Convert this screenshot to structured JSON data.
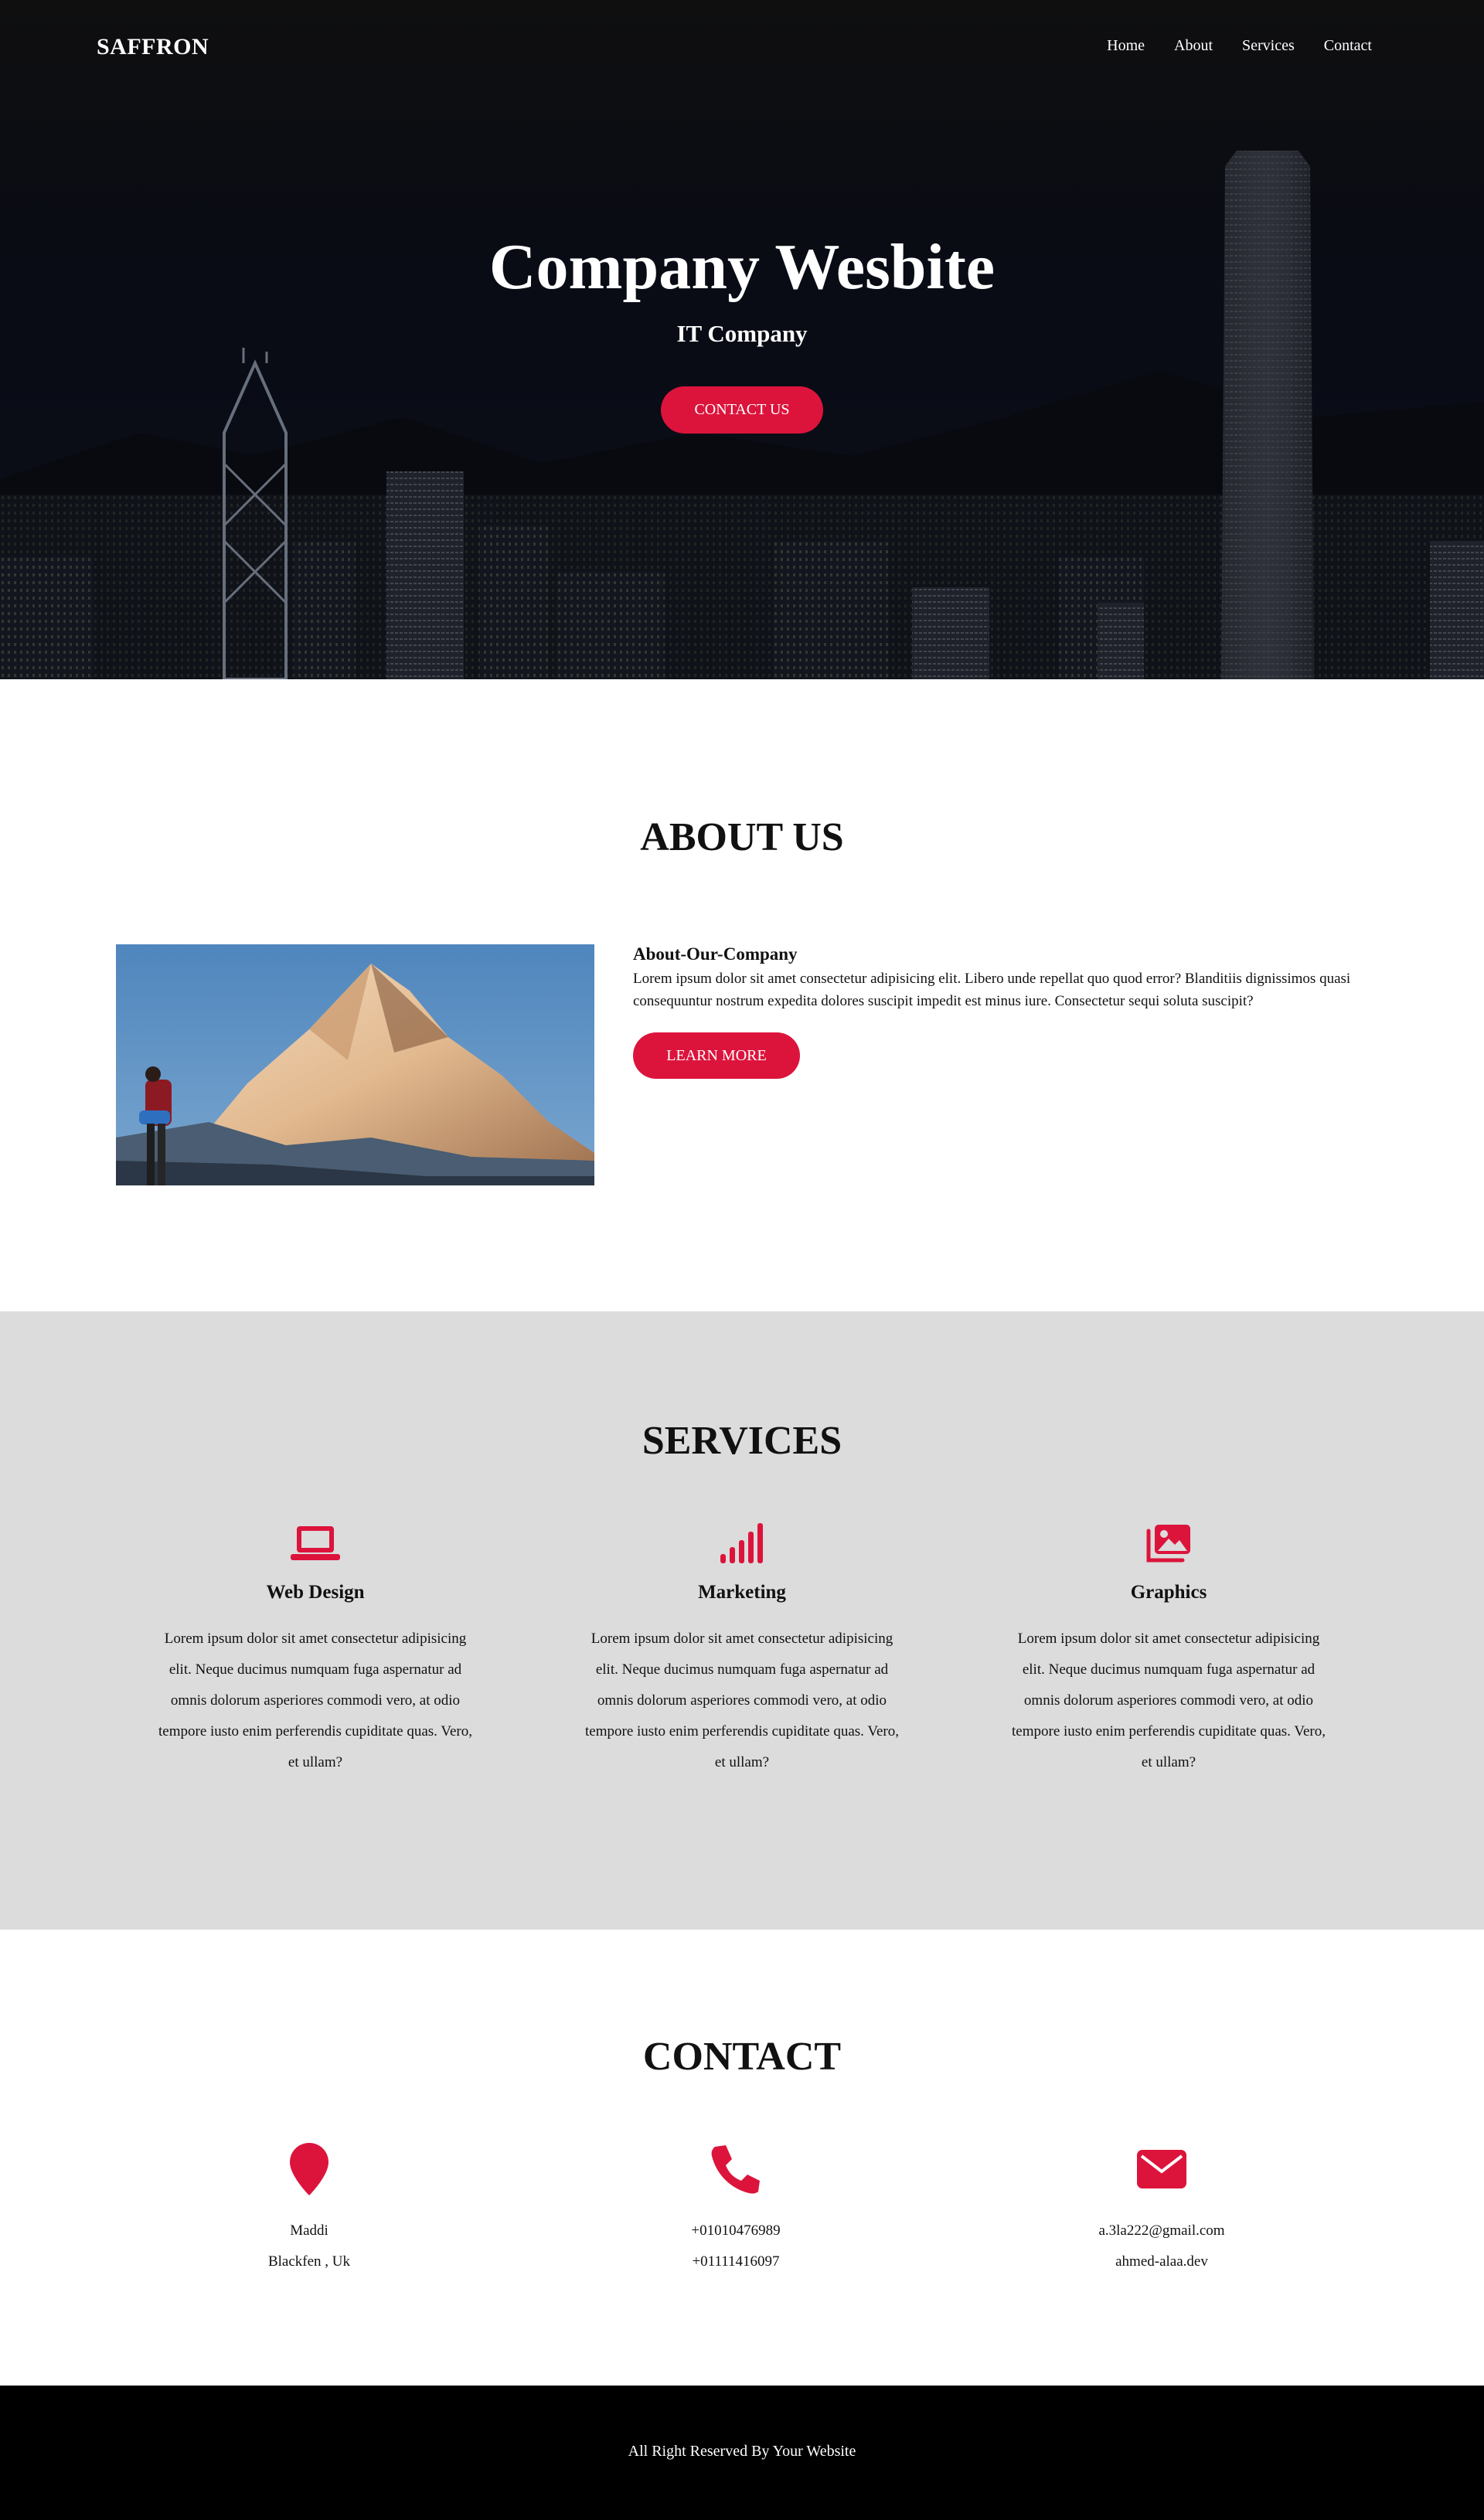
{
  "nav": {
    "brand": "SAFFRON",
    "links": [
      "Home",
      "About",
      "Services",
      "Contact"
    ]
  },
  "hero": {
    "title": "Company Wesbite",
    "subtitle": "IT Company",
    "button": "CONTACT US"
  },
  "about": {
    "title": "ABOUT US",
    "heading": "About-Our-Company",
    "paragraph": "Lorem ipsum dolor sit amet consectetur adipisicing elit. Libero unde repellat quo quod error? Blanditiis dignissimos quasi consequuntur nostrum expedita dolores suscipit impedit est minus iure. Consectetur sequi soluta suscipit?",
    "button": "LEARN MORE"
  },
  "services": {
    "title": "SERVICES",
    "items": [
      {
        "icon": "laptop-icon",
        "name": "Web Design",
        "desc": "Lorem ipsum dolor sit amet consectetur adipisicing elit. Neque ducimus numquam fuga aspernatur ad omnis dolorum asperiores commodi vero, at odio tempore iusto enim perferendis cupiditate quas. Vero, et ullam?"
      },
      {
        "icon": "signal-icon",
        "name": "Marketing",
        "desc": "Lorem ipsum dolor sit amet consectetur adipisicing elit. Neque ducimus numquam fuga aspernatur ad omnis dolorum asperiores commodi vero, at odio tempore iusto enim perferendis cupiditate quas. Vero, et ullam?"
      },
      {
        "icon": "images-icon",
        "name": "Graphics",
        "desc": "Lorem ipsum dolor sit amet consectetur adipisicing elit. Neque ducimus numquam fuga aspernatur ad omnis dolorum asperiores commodi vero, at odio tempore iusto enim perferendis cupiditate quas. Vero, et ullam?"
      }
    ]
  },
  "contact": {
    "title": "CONTACT",
    "items": [
      {
        "icon": "location-pin-icon",
        "lines": [
          "Maddi",
          "Blackfen , Uk"
        ]
      },
      {
        "icon": "phone-icon",
        "lines": [
          "+01010476989",
          "+01111416097"
        ]
      },
      {
        "icon": "envelope-icon",
        "lines": [
          "a.3la222@gmail.com",
          "ahmed-alaa.dev"
        ]
      }
    ]
  },
  "footer": {
    "text": "All Right Reserved By Your Website"
  },
  "colors": {
    "accent": "#dc143c",
    "services_bg": "#dcdcdc",
    "footer_bg": "#000000"
  }
}
